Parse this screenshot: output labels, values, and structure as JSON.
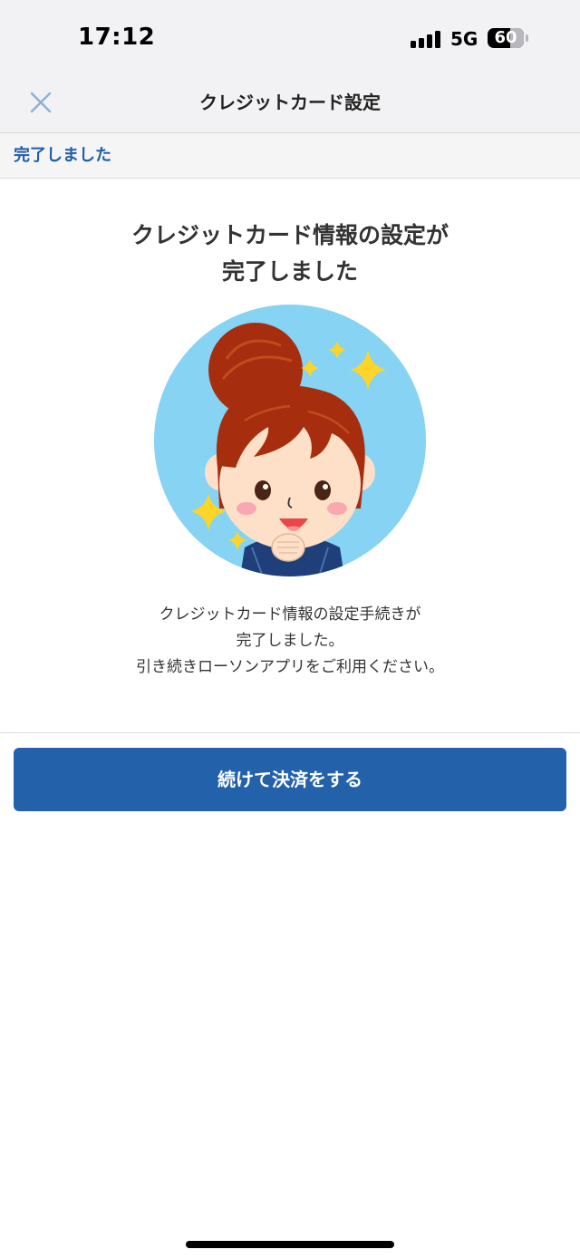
{
  "status_bar": {
    "time": "17:12",
    "network": "5G",
    "battery": "60",
    "icons": [
      "signal-icon",
      "battery-icon"
    ]
  },
  "nav": {
    "title": "クレジットカード設定",
    "close_icon": "close-icon"
  },
  "step": {
    "label": "完了しました"
  },
  "main": {
    "headline_lines": [
      "クレジットカード情報の設定が",
      "完了しました"
    ],
    "illustration": "mascot-clerk-illustration",
    "message_lines": [
      "クレジットカード情報の設定手続きが",
      "完了しました。",
      "引き続きローソンアプリをご利用ください。"
    ]
  },
  "actions": {
    "continue_label": "続けて決済をする"
  },
  "colors": {
    "accent": "#2362ab",
    "step_text": "#1f5fa8",
    "illustration_bg": "#86d3f3",
    "sparkle": "#fcd42a",
    "hair": "#a62e0e"
  }
}
